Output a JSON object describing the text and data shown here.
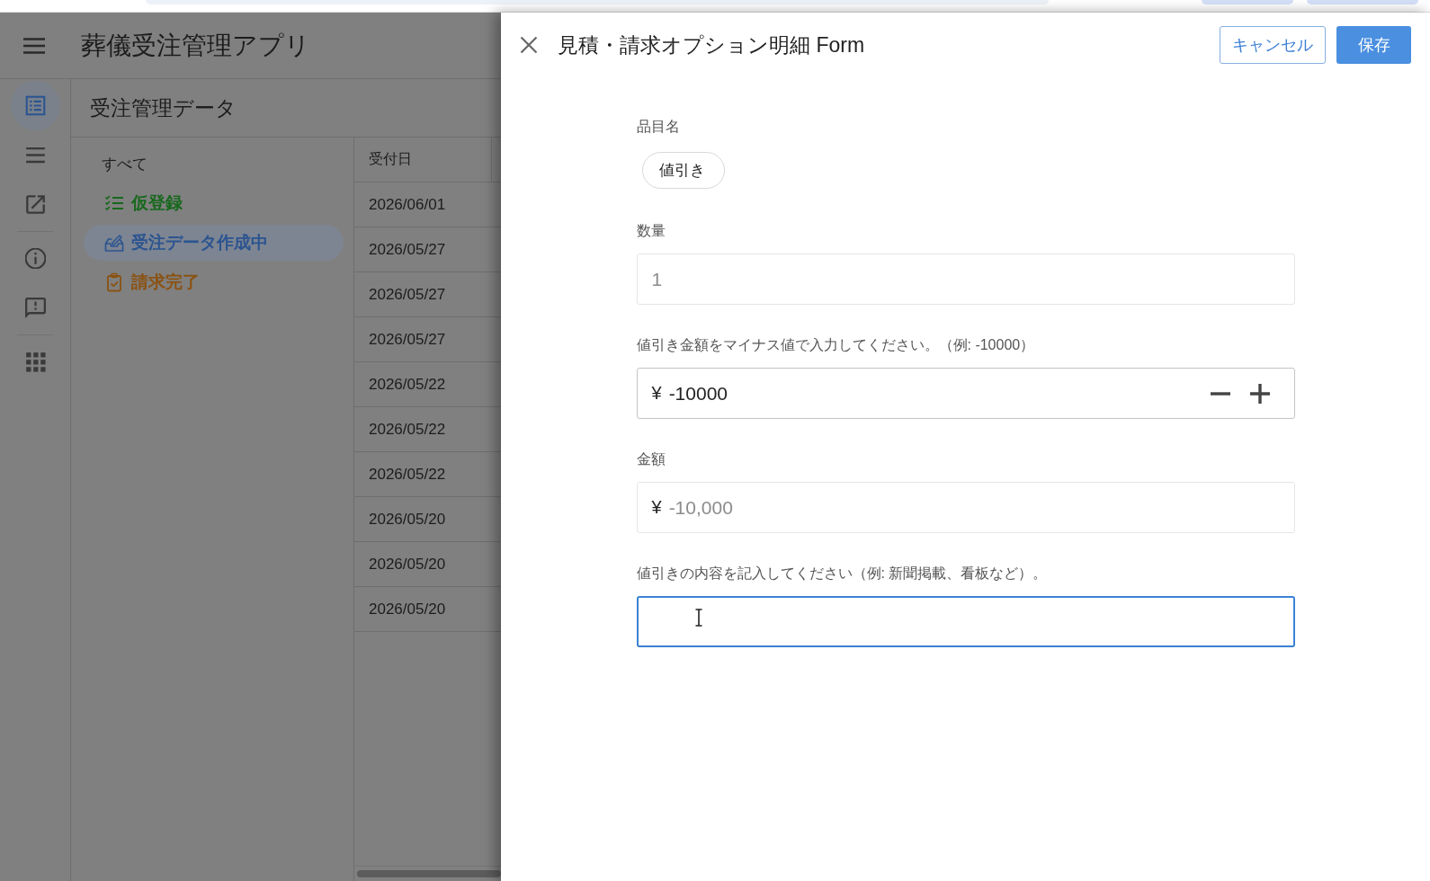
{
  "app": {
    "title": "葬儀受注管理アプリ",
    "rail": [
      [
        {
          "selected": true
        },
        {
          "selected": false
        },
        {
          "selected": false
        }
      ],
      [
        {
          "selected": false
        },
        {
          "selected": false
        }
      ],
      [
        {
          "selected": false
        }
      ]
    ],
    "section_title": "受注管理データ",
    "filters": [
      {
        "label": "すべて",
        "selected": false
      },
      {
        "label": "仮登録",
        "color": "#17681d",
        "selected": false
      },
      {
        "label": "受注データ作成中",
        "color": "#2b5490",
        "selected": true
      },
      {
        "label": "請求完了",
        "color": "#8a5212",
        "selected": false
      }
    ],
    "table": {
      "columns": [
        "受付日"
      ],
      "rows": [
        [
          "2026/06/01"
        ],
        [
          "2026/05/27"
        ],
        [
          "2026/05/27"
        ],
        [
          "2026/05/27"
        ],
        [
          "2026/05/22"
        ],
        [
          "2026/05/22"
        ],
        [
          "2026/05/22"
        ],
        [
          "2026/05/20"
        ],
        [
          "2026/05/20"
        ],
        [
          "2026/05/20"
        ]
      ]
    }
  },
  "panel": {
    "title": "見積・請求オプション明細 Form",
    "buttons": [
      {
        "label": "キャンセル",
        "kind": "outlined"
      },
      {
        "label": "保存",
        "kind": "filled"
      }
    ],
    "fields": [
      {
        "kind": "chip",
        "label": "品目名",
        "value": "値引き",
        "disabled": false,
        "focused": false
      },
      {
        "kind": "number",
        "label": "数量",
        "value": "1",
        "disabled": true,
        "focused": false,
        "stepper": false
      },
      {
        "kind": "currency",
        "label": "値引き金額をマイナス値で入力してください。（例: -10000）",
        "prefix": "¥",
        "value": "-10000",
        "disabled": false,
        "focused": false,
        "stepper": true
      },
      {
        "kind": "currency",
        "label": "金額",
        "prefix": "¥",
        "value": "-10,000",
        "disabled": true,
        "focused": false,
        "stepper": false
      },
      {
        "kind": "text",
        "label": "値引きの内容を記入してください（例: 新聞掲載、看板など）。",
        "disabled": false,
        "focused": true,
        "stepper": false
      }
    ]
  }
}
